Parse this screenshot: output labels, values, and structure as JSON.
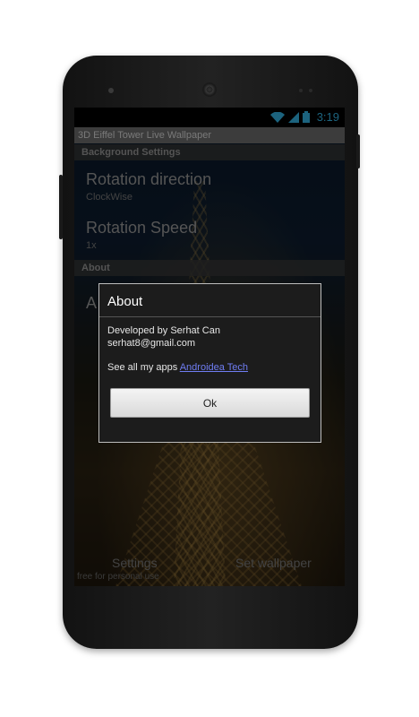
{
  "status_bar": {
    "time": "3:19",
    "icons": [
      "wifi-icon",
      "signal-icon",
      "battery-icon"
    ],
    "accent_color": "#33b5e5"
  },
  "app": {
    "title": "3D Eiffel Tower Live Wallpaper"
  },
  "settings": {
    "background_header": "Background Settings",
    "rotation_direction": {
      "title": "Rotation direction",
      "value": "ClockWise"
    },
    "rotation_speed": {
      "title": "Rotation Speed",
      "value": "1x"
    },
    "about_header": "About",
    "about_item_partial": "A"
  },
  "dialog": {
    "title": "About",
    "developer": "Developed by Serhat Can",
    "email": "serhat8@gmail.com",
    "apps_prefix": "See all my apps",
    "apps_link": "Androidea Tech",
    "ok_label": "Ok"
  },
  "bottom_bar": {
    "settings_label": "Settings",
    "set_wallpaper_label": "Set wallpaper",
    "note": "free for personal use"
  }
}
